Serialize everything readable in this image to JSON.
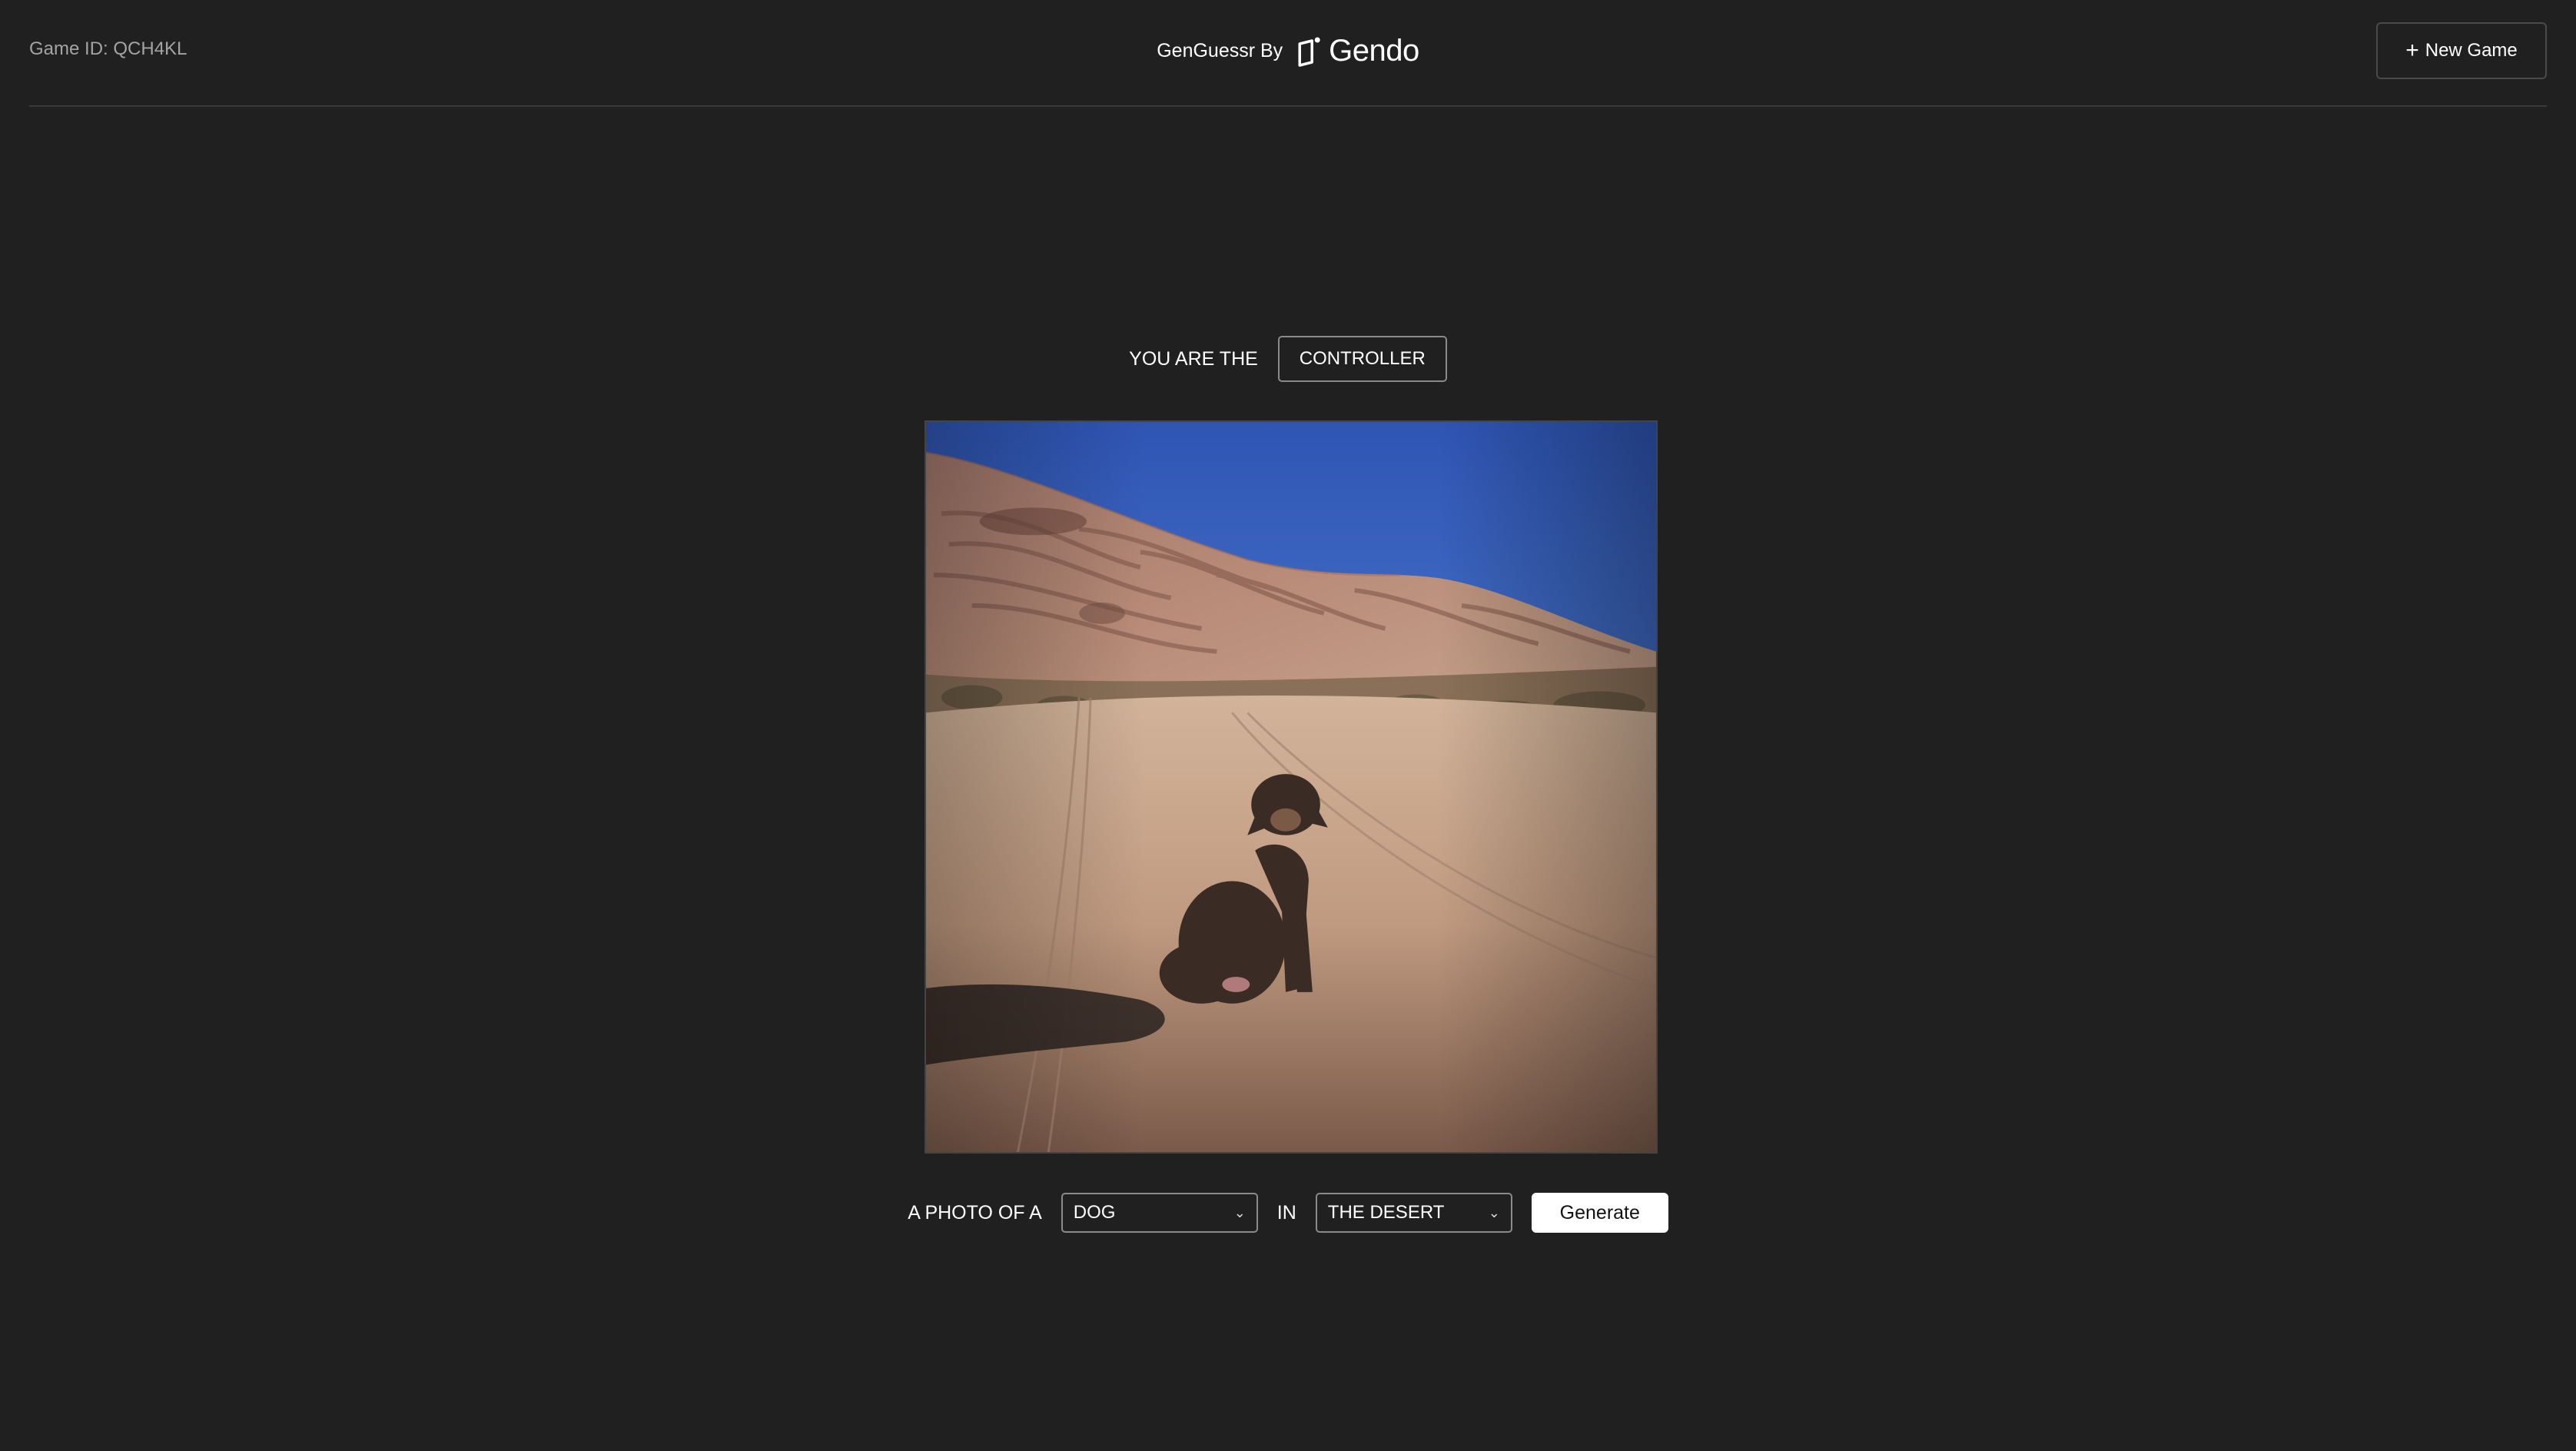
{
  "header": {
    "game_id": "Game ID: QCH4KL",
    "brand_prefix": "GenGuessr By",
    "brand_name": "Gendo",
    "new_game_label": "New Game",
    "new_game_icon": "plus-icon"
  },
  "role": {
    "label": "YOU ARE THE",
    "value": "CONTROLLER"
  },
  "image": {
    "icon": "generated-photo-dog-in-desert"
  },
  "prompt": {
    "prefix": "A PHOTO OF A",
    "subject": "DOG",
    "joiner": "IN",
    "location": "THE DESERT",
    "dropdown_icon": "chevron-down-icon",
    "generate_label": "Generate"
  },
  "colors": {
    "background": "#202020",
    "divider": "#3a3a3a",
    "muted_text": "#a4a4a4",
    "button_primary_bg": "#ffffff"
  }
}
